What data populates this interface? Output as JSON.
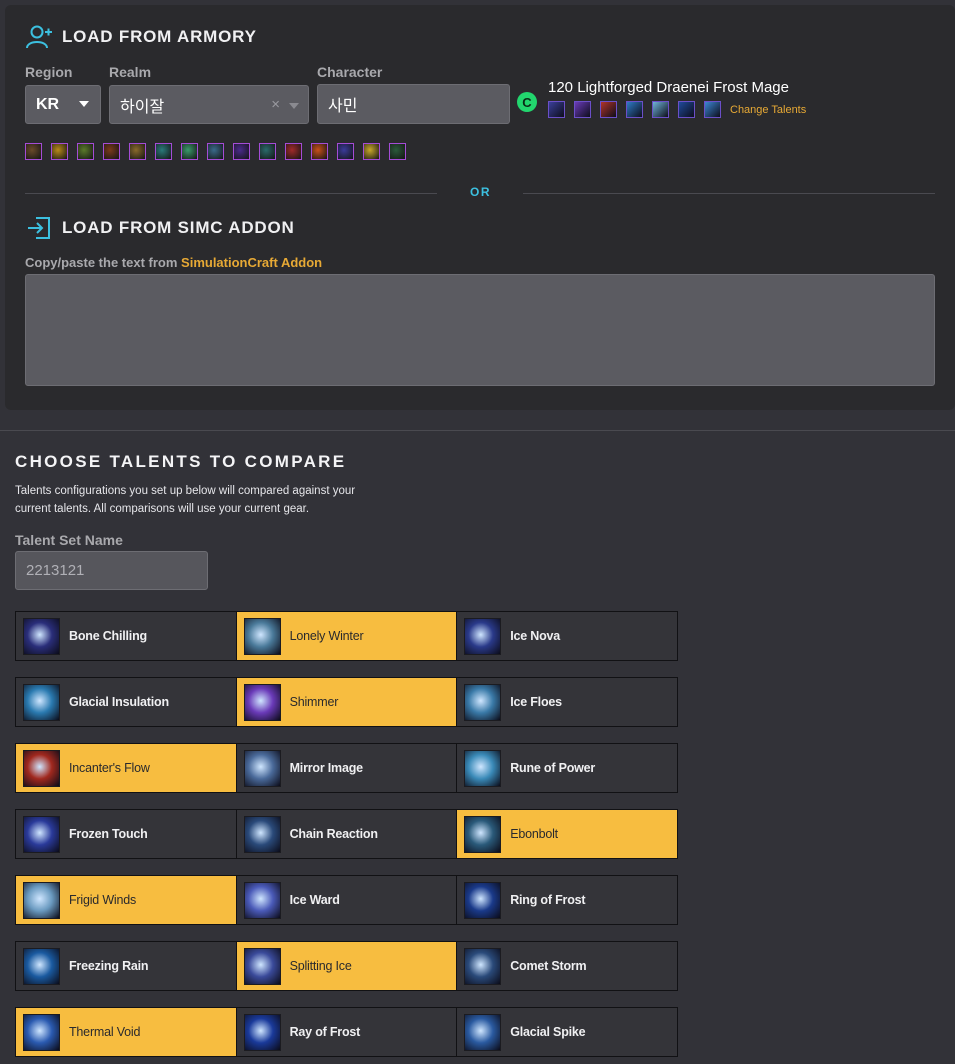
{
  "armory": {
    "title": "LOAD FROM ARMORY",
    "region_label": "Region",
    "region_value": "KR",
    "realm_label": "Realm",
    "realm_value": "하이잘",
    "clear_symbol": "×",
    "character_label": "Character",
    "character_value": "사민",
    "status_glyph": "C",
    "character_summary": "120 Lightforged Draenei Frost Mage",
    "change_talents": "Change Talents",
    "talent_icon_colors": [
      "#3a3f9a",
      "#6a3bb8",
      "#b0342a",
      "#2e7bc6",
      "#6fb3d8",
      "#1f4a9c",
      "#3c86d4"
    ],
    "gear_icon_colors": [
      "#6a4a2a",
      "#b88a1a",
      "#5a7a2a",
      "#7a3a1a",
      "#8a6a2a",
      "#2a7a7a",
      "#3a9a6a",
      "#3a6a8a",
      "#4a2a8a",
      "#2a6a6a",
      "#a02a2a",
      "#c8501a",
      "#3a3a9a",
      "#c8a82a",
      "#2a5a3a"
    ]
  },
  "divider": {
    "or_label": "OR"
  },
  "addon": {
    "title": "LOAD FROM SIMC ADDON",
    "copy_text": "Copy/paste the text from ",
    "link_text": "SimulationCraft Addon"
  },
  "compare": {
    "title": "CHOOSE TALENTS TO COMPARE",
    "description": "Talents configurations you set up below will compared against your current talents. All comparisons will use your current gear.",
    "set_name_label": "Talent Set Name",
    "set_name_placeholder": "2213121"
  },
  "talent_rows": [
    [
      {
        "name": "Bone Chilling",
        "selected": false,
        "color": "#2a2e7a"
      },
      {
        "name": "Lonely Winter",
        "selected": true,
        "color": "#4a7a9a"
      },
      {
        "name": "Ice Nova",
        "selected": false,
        "color": "#2a3a8a"
      }
    ],
    [
      {
        "name": "Glacial Insulation",
        "selected": false,
        "color": "#2a7ab0"
      },
      {
        "name": "Shimmer",
        "selected": true,
        "color": "#6a3ab8"
      },
      {
        "name": "Ice Floes",
        "selected": false,
        "color": "#3a7aa8"
      }
    ],
    [
      {
        "name": "Incanter's Flow",
        "selected": true,
        "color": "#a0281e"
      },
      {
        "name": "Mirror Image",
        "selected": false,
        "color": "#4a6a9a"
      },
      {
        "name": "Rune of Power",
        "selected": false,
        "color": "#3a8ab8"
      }
    ],
    [
      {
        "name": "Frozen Touch",
        "selected": false,
        "color": "#2a3a9a"
      },
      {
        "name": "Chain Reaction",
        "selected": false,
        "color": "#2a4a7a"
      },
      {
        "name": "Ebonbolt",
        "selected": true,
        "color": "#2a5a7a"
      }
    ],
    [
      {
        "name": "Frigid Winds",
        "selected": true,
        "color": "#6a9ac0"
      },
      {
        "name": "Ice Ward",
        "selected": false,
        "color": "#4a5ab8"
      },
      {
        "name": "Ring of Frost",
        "selected": false,
        "color": "#1a3a8a"
      }
    ],
    [
      {
        "name": "Freezing Rain",
        "selected": false,
        "color": "#1a5aa0"
      },
      {
        "name": "Splitting Ice",
        "selected": true,
        "color": "#3a4a9a"
      },
      {
        "name": "Comet Storm",
        "selected": false,
        "color": "#2a4a7a"
      }
    ],
    [
      {
        "name": "Thermal Void",
        "selected": true,
        "color": "#2a5ab0"
      },
      {
        "name": "Ray of Frost",
        "selected": false,
        "color": "#1a3a9a"
      },
      {
        "name": "Glacial Spike",
        "selected": false,
        "color": "#2a5aa0"
      }
    ]
  ]
}
